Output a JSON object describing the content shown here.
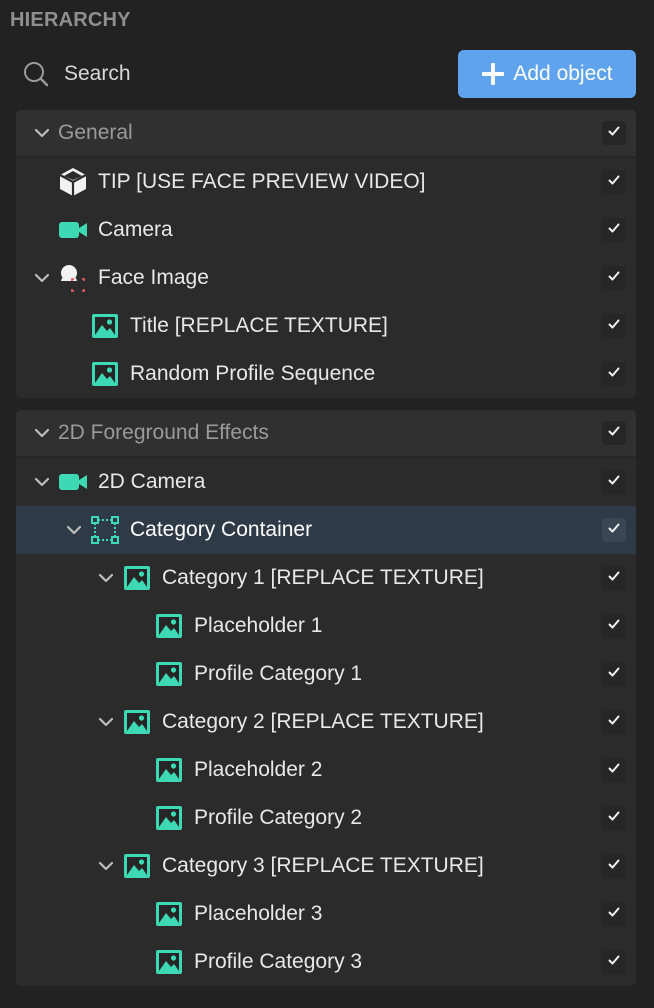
{
  "panel": {
    "title": "HIERARCHY",
    "search_placeholder": "Search",
    "add_label": "Add object"
  },
  "colors": {
    "accent": "#5fa3ee",
    "icon_teal": "#3dd9b4",
    "background": "#222222",
    "selected_row": "#2f3a47",
    "face_marker": "#e05a5a"
  },
  "groups": [
    {
      "label": "General",
      "items": [
        {
          "label": "TIP  [USE FACE PREVIEW VIDEO]",
          "icon": "cube-icon",
          "depth": 0,
          "expandable": false,
          "checked": true
        },
        {
          "label": "Camera",
          "icon": "camera-icon",
          "depth": 0,
          "expandable": false,
          "checked": true
        },
        {
          "label": "Face Image",
          "icon": "face-image-icon",
          "depth": 0,
          "expandable": true,
          "checked": true
        },
        {
          "label": "Title [REPLACE TEXTURE]",
          "icon": "image-icon",
          "depth": 1,
          "expandable": false,
          "checked": true
        },
        {
          "label": "Random Profile Sequence",
          "icon": "image-icon",
          "depth": 1,
          "expandable": false,
          "checked": true
        }
      ]
    },
    {
      "label": "2D Foreground Effects",
      "items": [
        {
          "label": "2D Camera",
          "icon": "camera-icon",
          "depth": 0,
          "expandable": true,
          "checked": true
        },
        {
          "label": "Category Container",
          "icon": "container-icon",
          "depth": 1,
          "expandable": true,
          "checked": true,
          "selected": true
        },
        {
          "label": "Category 1 [REPLACE TEXTURE]",
          "icon": "image-icon",
          "depth": 2,
          "expandable": true,
          "checked": true
        },
        {
          "label": "Placeholder 1",
          "icon": "image-icon",
          "depth": 3,
          "expandable": false,
          "checked": true
        },
        {
          "label": "Profile Category 1",
          "icon": "image-icon",
          "depth": 3,
          "expandable": false,
          "checked": true
        },
        {
          "label": "Category 2 [REPLACE TEXTURE]",
          "icon": "image-icon",
          "depth": 2,
          "expandable": true,
          "checked": true
        },
        {
          "label": "Placeholder 2",
          "icon": "image-icon",
          "depth": 3,
          "expandable": false,
          "checked": true
        },
        {
          "label": "Profile Category 2",
          "icon": "image-icon",
          "depth": 3,
          "expandable": false,
          "checked": true
        },
        {
          "label": "Category 3 [REPLACE TEXTURE]",
          "icon": "image-icon",
          "depth": 2,
          "expandable": true,
          "checked": true
        },
        {
          "label": "Placeholder 3",
          "icon": "image-icon",
          "depth": 3,
          "expandable": false,
          "checked": true
        },
        {
          "label": "Profile Category 3",
          "icon": "image-icon",
          "depth": 3,
          "expandable": false,
          "checked": true
        }
      ]
    }
  ]
}
